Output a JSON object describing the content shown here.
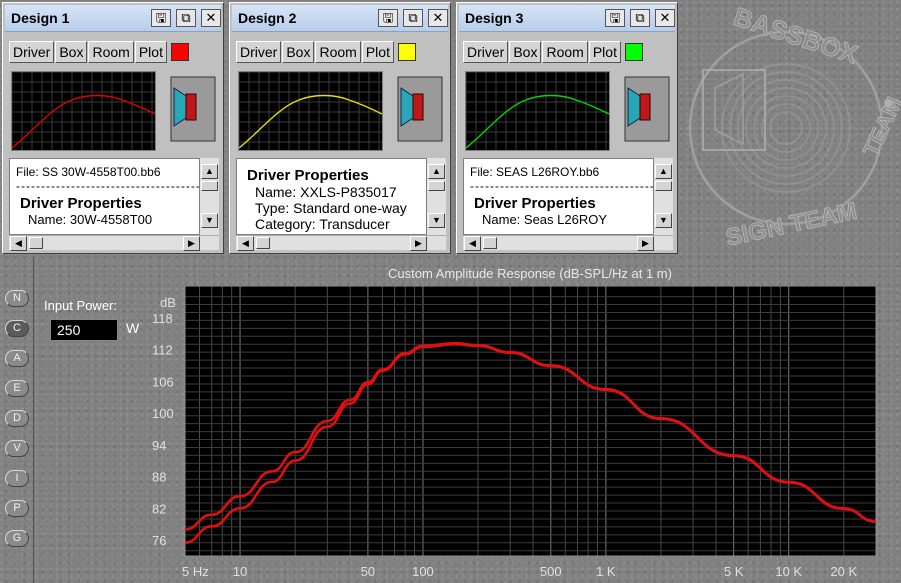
{
  "designs": [
    {
      "title": "Design 1",
      "tabs": [
        "Driver",
        "Box",
        "Room",
        "Plot"
      ],
      "plot_color": "#ff0000",
      "curve_color": "#e00000",
      "title_icons": [
        "save-icon",
        "copy-icon",
        "close-icon"
      ],
      "title_glyphs": [
        "🖫",
        "⧉",
        "✕"
      ],
      "file": "File: SS 30W-4558T00.bb6",
      "dashes": "--------------------------------------------",
      "heading": "Driver Properties",
      "lines": [
        "Name: 30W-4558T00"
      ],
      "first": "file"
    },
    {
      "title": "Design 2",
      "tabs": [
        "Driver",
        "Box",
        "Room",
        "Plot"
      ],
      "plot_color": "#ffff00",
      "curve_color": "#e8e000",
      "title_icons": [
        "save-icon",
        "copy-icon",
        "close-icon"
      ],
      "title_glyphs": [
        "🖫",
        "⧉",
        "✕"
      ],
      "file": "",
      "dashes": "",
      "heading": "Driver Properties",
      "lines": [
        "Name: XXLS-P835017",
        "Type: Standard one-way",
        "Category: Transducer"
      ],
      "first": "heading"
    },
    {
      "title": "Design 3",
      "tabs": [
        "Driver",
        "Box",
        "Room",
        "Plot"
      ],
      "plot_color": "#00ff00",
      "curve_color": "#00d800",
      "title_icons": [
        "save-icon",
        "copy-icon",
        "close-icon"
      ],
      "title_glyphs": [
        "🖫",
        "⧉",
        "✕"
      ],
      "file": "File: SEAS L26ROY.bb6",
      "dashes": "--------------------------------------------",
      "heading": "Driver Properties",
      "lines": [
        "Name: Seas L26ROY"
      ],
      "first": "file"
    }
  ],
  "logo_text": "BASSBOX DESIGN TEAM",
  "side_buttons": [
    {
      "label": "N",
      "active": false
    },
    {
      "label": "C",
      "active": true
    },
    {
      "label": "A",
      "active": false
    },
    {
      "label": "E",
      "active": false
    },
    {
      "label": "D",
      "active": false
    },
    {
      "label": "V",
      "active": false
    },
    {
      "label": "I",
      "active": false
    },
    {
      "label": "P",
      "active": false
    },
    {
      "label": "G",
      "active": false
    }
  ],
  "input_power": {
    "label": "Input Power:",
    "value": "250",
    "unit": "W"
  },
  "chart_data": {
    "type": "line",
    "title": "Custom Amplitude Response (dB-SPL/Hz at 1 m)",
    "ylabel": "dB",
    "xscale": "log",
    "xlim": [
      5,
      30000
    ],
    "ylim": [
      73,
      124
    ],
    "y_ticks": [
      118,
      112,
      106,
      100,
      94,
      88,
      82,
      76
    ],
    "x_tick_labels": [
      {
        "v": 5,
        "t": "5 Hz"
      },
      {
        "v": 10,
        "t": "10"
      },
      {
        "v": 50,
        "t": "50"
      },
      {
        "v": 100,
        "t": "100"
      },
      {
        "v": 500,
        "t": "500"
      },
      {
        "v": 1000,
        "t": "1 K"
      },
      {
        "v": 5000,
        "t": "5 K"
      },
      {
        "v": 10000,
        "t": "10 K"
      },
      {
        "v": 20000,
        "t": "20 K"
      }
    ],
    "grid": true,
    "background": "#000000",
    "series": [
      {
        "color": "#e01010",
        "x": [
          5,
          7,
          10,
          15,
          20,
          30,
          40,
          50,
          60,
          80,
          100,
          150,
          200,
          300,
          500,
          1000,
          2000,
          5000,
          10000,
          20000,
          30000
        ],
        "y": [
          78,
          80.8,
          84.3,
          89,
          92.6,
          98.5,
          102.5,
          105.8,
          108.2,
          111.3,
          112.7,
          113.2,
          112.8,
          111.5,
          109,
          104.5,
          99,
          92,
          87,
          82,
          79.5
        ]
      },
      {
        "color": "#e01010",
        "x": [
          5,
          7,
          10,
          15,
          20,
          30,
          40,
          50,
          60,
          80,
          100,
          150,
          200,
          300,
          500,
          1000,
          2000,
          5000,
          10000,
          20000,
          30000
        ],
        "y": [
          75.5,
          78.6,
          82,
          87,
          91,
          97.4,
          101.8,
          105.4,
          108,
          111.1,
          112.5,
          113,
          112.7,
          111.4,
          108.9,
          104.4,
          98.9,
          91.9,
          86.9,
          81.9,
          79.5
        ]
      }
    ]
  }
}
